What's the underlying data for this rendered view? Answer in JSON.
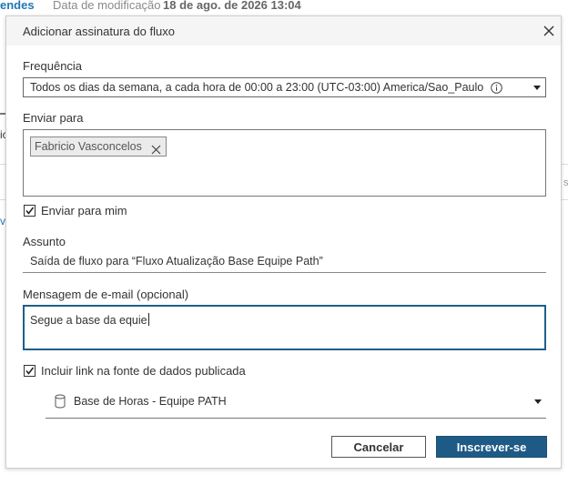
{
  "background": {
    "link_text": "endes",
    "modified_label": "Data de modificação",
    "modified_date": "18 de ago. de 2026 13:04",
    "left_fragment": "ic",
    "left_fragment_2": "v",
    "right_fragment": "s"
  },
  "dialog": {
    "title": "Adicionar assinatura do fluxo",
    "frequency": {
      "label": "Frequência",
      "value": "Todos os dias da semana, a cada hora de 00:00 a 23:00 (UTC-03:00) America/Sao_Paulo"
    },
    "send_to": {
      "label": "Enviar para",
      "recipients": [
        "Fabricio Vasconcelos"
      ]
    },
    "send_to_me": {
      "label": "Enviar para mim",
      "checked": true
    },
    "subject": {
      "label": "Assunto",
      "value": "Saída de fluxo para “Fluxo Atualização Base Equipe Path”"
    },
    "message": {
      "label": "Mensagem de e-mail (opcional)",
      "value": "Segue a base da equie"
    },
    "include_link": {
      "label": "Incluir link na fonte de dados publicada",
      "checked": true
    },
    "data_source": {
      "value": "Base de Horas - Equipe PATH"
    },
    "buttons": {
      "cancel": "Cancelar",
      "subscribe": "Inscrever-se"
    }
  },
  "colors": {
    "primary": "#1e5a86",
    "focus_border": "#1d5f8a",
    "link": "#1f77b4"
  },
  "icons": [
    "close-icon",
    "info-icon",
    "chevron-down-icon",
    "remove-icon",
    "check-icon",
    "database-icon"
  ]
}
